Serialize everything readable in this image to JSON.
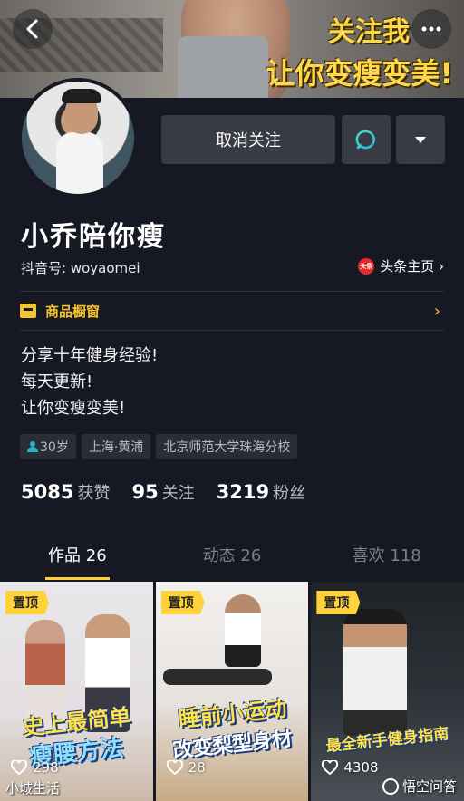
{
  "banner": {
    "line1": "关注我",
    "line2": "让你变瘦变美!"
  },
  "profile": {
    "unfollow_label": "取消关注",
    "nickname": "小乔陪你瘦",
    "douyin_id": "抖音号: woyaomei",
    "toutiao_logo_text": "头条",
    "toutiao_label": "头条主页 ›",
    "shop_label": "商品橱窗",
    "bio": [
      "分享十年健身经验!",
      "每天更新!",
      "让你变瘦变美!"
    ],
    "tags": [
      "30岁",
      "上海·黄浦",
      "北京师范大学珠海分校"
    ]
  },
  "stats": [
    {
      "num": "5085",
      "label": "获赞"
    },
    {
      "num": "95",
      "label": "关注"
    },
    {
      "num": "3219",
      "label": "粉丝"
    }
  ],
  "tabs": [
    "作品 26",
    "动态 26",
    "喜欢 118"
  ],
  "videos": [
    {
      "pin": "置顶",
      "title1": "史上最简单",
      "title2": "瘦腰方法",
      "likes": "298"
    },
    {
      "pin": "置顶",
      "title1": "睡前小运动",
      "title2": "改变梨型身材",
      "likes": "28"
    },
    {
      "pin": "置顶",
      "title1": "最全新手健身指南",
      "likes": "4308"
    }
  ],
  "watermarks": {
    "left": "小城生活",
    "right": "悟空问答"
  },
  "colors": {
    "background": "#161823",
    "accent": "#fdcf2f",
    "button": "#393b44"
  }
}
